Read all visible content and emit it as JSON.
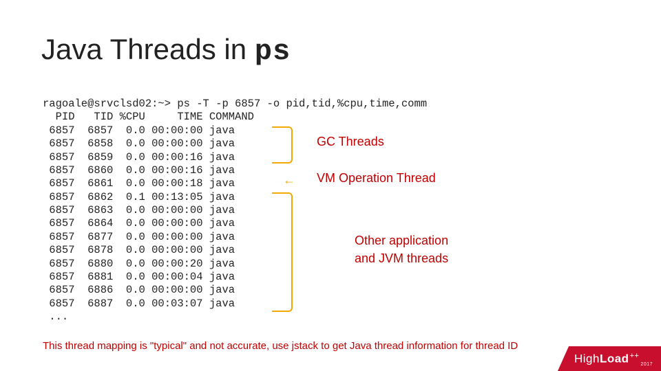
{
  "title": {
    "prefix": "Java Threads in ",
    "cmd": "ps"
  },
  "terminal": {
    "prompt": "ragoale@srvclsd02:~> ps -T -p 6857 -o pid,tid,%cpu,time,comm",
    "header": "  PID   TID %CPU     TIME COMMAND",
    "rows": [
      " 6857  6857  0.0 00:00:00 java",
      " 6857  6858  0.0 00:00:00 java",
      " 6857  6859  0.0 00:00:16 java",
      " 6857  6860  0.0 00:00:16 java",
      " 6857  6861  0.0 00:00:18 java",
      " 6857  6862  0.1 00:13:05 java",
      " 6857  6863  0.0 00:00:00 java",
      " 6857  6864  0.0 00:00:00 java",
      " 6857  6877  0.0 00:00:00 java",
      " 6857  6878  0.0 00:00:00 java",
      " 6857  6880  0.0 00:00:20 java",
      " 6857  6881  0.0 00:00:04 java",
      " 6857  6886  0.0 00:00:00 java",
      " 6857  6887  0.0 00:03:07 java"
    ],
    "ellipsis": " ..."
  },
  "annotations": {
    "gc": "GC Threads",
    "vm": "VM Operation Thread",
    "other_line1": "Other application",
    "other_line2": "and JVM threads",
    "arrow_glyph": "←"
  },
  "footnote": "This thread mapping is \"typical\" and not accurate, use jstack to get Java thread information for thread ID",
  "brand": {
    "dim": "High",
    "strong": "Load",
    "plus": "++",
    "year": "2017"
  }
}
